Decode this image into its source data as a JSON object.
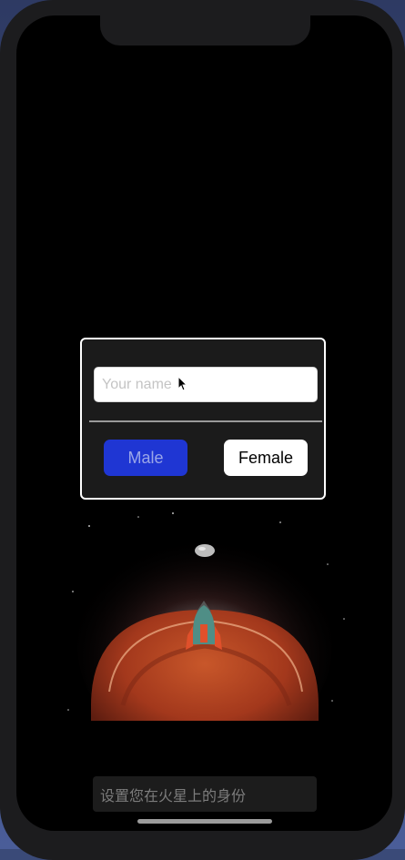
{
  "dialog": {
    "name_placeholder": "Your name",
    "name_value": "",
    "male_label": "Male",
    "female_label": "Female"
  },
  "bottom": {
    "hint_text": "设置您在火星上的身份"
  },
  "colors": {
    "male_button": "#1f36d3",
    "female_button": "#ffffff",
    "planet": "#b4421f",
    "rocket": "#4f8e86"
  },
  "icons": [
    "cursor-icon",
    "mars-planet-icon",
    "rocket-icon",
    "moon-icon"
  ]
}
